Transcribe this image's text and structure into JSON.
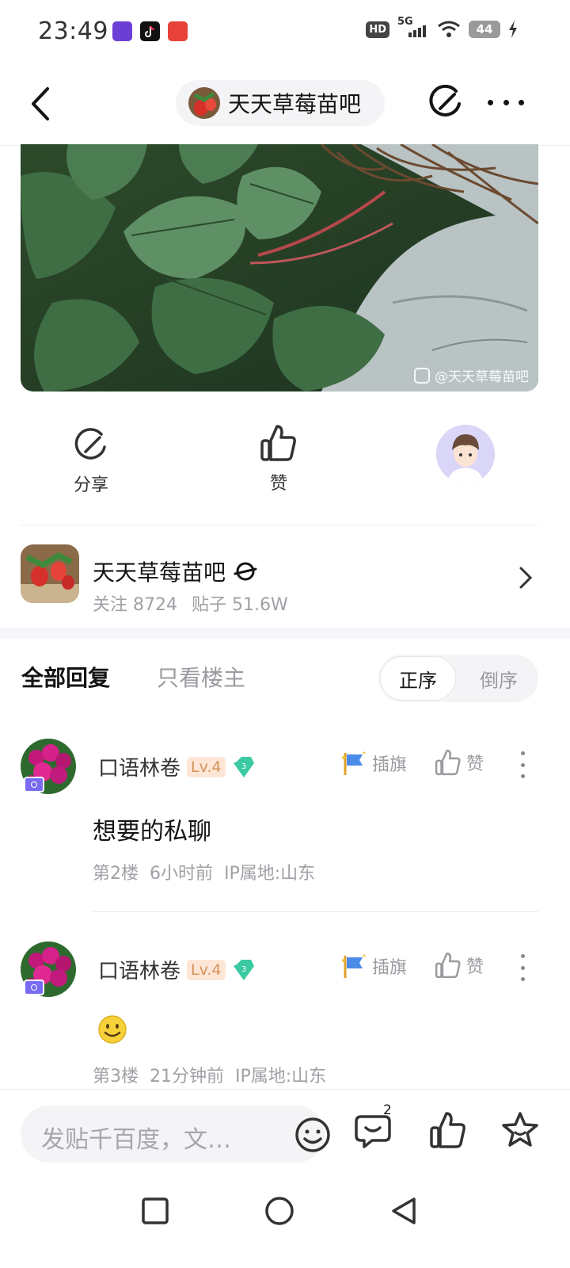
{
  "status_bar": {
    "time": "23:49",
    "network": "5G",
    "hd_label": "HD",
    "battery": "44",
    "notification_icons": [
      "app-notification-icon",
      "tiktok-icon",
      "xiaohongshu-icon"
    ]
  },
  "top_nav": {
    "forum_name": "天天草莓苗吧"
  },
  "post_image": {
    "watermark": "@天天草莓苗吧"
  },
  "actions": {
    "share_label": "分享",
    "like_label": "赞"
  },
  "forum_card": {
    "name": "天天草莓苗吧",
    "follow_stat": "关注 8724",
    "post_stat": "贴子 51.6W"
  },
  "tabs": {
    "all_replies": "全部回复",
    "op_only": "只看楼主",
    "sort_asc": "正序",
    "sort_desc": "倒序"
  },
  "replies": [
    {
      "username": "口语林卷",
      "level": "Lv.4",
      "gem_level": "3",
      "flag_label": "插旗",
      "like_label": "赞",
      "content": "想要的私聊",
      "floor": "第2楼",
      "time": "6小时前",
      "ip": "IP属地:山东"
    },
    {
      "username": "口语林卷",
      "level": "Lv.4",
      "gem_level": "3",
      "flag_label": "插旗",
      "like_label": "赞",
      "content": "",
      "floor": "第3楼",
      "time": "21分钟前",
      "ip": "IP属地:山东"
    }
  ],
  "bottom_bar": {
    "placeholder": "发贴千百度，文…",
    "comment_count": "2"
  },
  "colors": {
    "accent_pill": "#f4f4f7",
    "level_badge_bg": "#fde6d6",
    "level_badge_text": "#d6925a",
    "gem": "#3ac9a0",
    "secondary_text": "#a0a0a6"
  }
}
